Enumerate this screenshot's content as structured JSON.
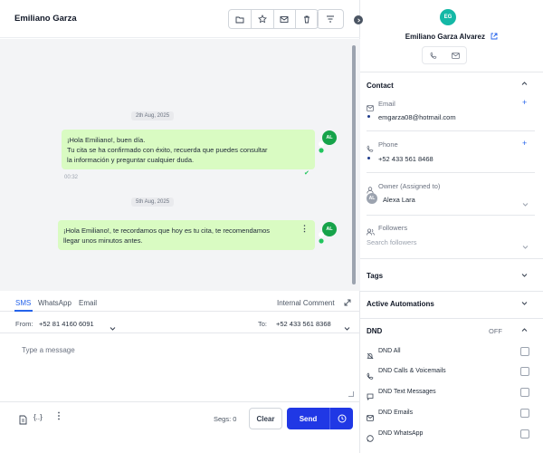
{
  "conversation": {
    "contact_name": "Emiliano Garza",
    "messages": [
      {
        "date": "2th Aug, 2025",
        "lines": [
          "¡Hola Emiliano!, buen día.",
          "Tu cita se ha confirmado con éxito, recuerda que puedes consultar",
          "la información y preguntar cualquier duda."
        ],
        "avatar": "AL",
        "time": "00:32"
      },
      {
        "date": "5th Aug, 2025",
        "lines": [
          "¡Hola Emiliano!, te recordamos que hoy es tu cita, te recomendamos",
          "llegar unos minutos antes."
        ],
        "avatar": "AL"
      }
    ]
  },
  "composer": {
    "tabs": [
      "SMS",
      "WhatsApp",
      "Email"
    ],
    "internal_comment": "Internal Comment",
    "from_label": "From:",
    "from_value": "+52 81 4160 6091",
    "to_label": "To:",
    "to_value": "+52 433 561 8368",
    "placeholder": "Type a message",
    "segs": "Segs: 0",
    "clear": "Clear",
    "send": "Send"
  },
  "contact": {
    "initials": "EG",
    "full_name": "Emiliano Garza Alvarez",
    "section_contact": "Contact",
    "email_label": "Email",
    "email_value": "emgarza08@hotmail.com",
    "phone_label": "Phone",
    "phone_value": "+52 433 561 8468",
    "owner_label": "Owner (Assigned to)",
    "owner_initials": "AL",
    "owner_value": "Alexa Lara",
    "followers_label": "Followers",
    "followers_placeholder": "Search followers",
    "tags": "Tags",
    "active_automations": "Active Automations",
    "dnd_title": "DND",
    "dnd_status": "OFF",
    "dnd_items": [
      "DND All",
      "DND Calls & Voicemails",
      "DND Text Messages",
      "DND Emails",
      "DND WhatsApp"
    ]
  },
  "colors": {
    "accent": "#2038e5",
    "bubble": "#d9fbc2",
    "avatar_green": "#16a34a",
    "avatar_teal": "#14b8a6"
  }
}
